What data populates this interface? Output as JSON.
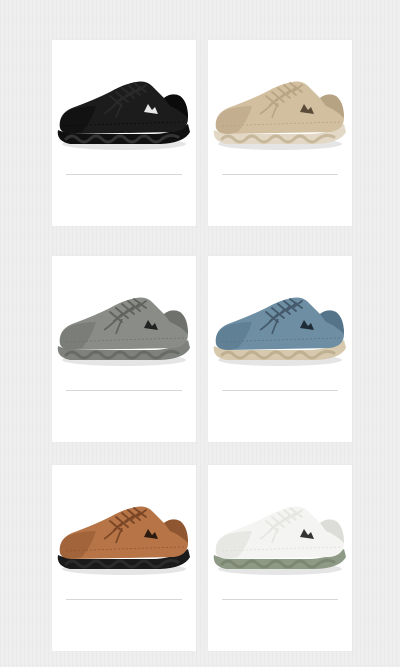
{
  "products": [
    {
      "id": "black",
      "upper": "#1c1c1c",
      "upper_dark": "#0b0b0b",
      "sole": "#101010",
      "lace": "#2a2a2a",
      "tread": "#333333",
      "logo": "#e8e8e8"
    },
    {
      "id": "beige",
      "upper": "#d2bfa0",
      "upper_dark": "#b6a384",
      "sole": "#e3d8c5",
      "lace": "#b9a583",
      "tread": "#c7b89b",
      "logo": "#5a4a38"
    },
    {
      "id": "grey",
      "upper": "#8a8d87",
      "upper_dark": "#6e716c",
      "sole": "#7e817c",
      "lace": "#5f625d",
      "tread": "#686b66",
      "logo": "#222222"
    },
    {
      "id": "blue",
      "upper": "#6e8ea4",
      "upper_dark": "#567489",
      "sole": "#d7c9ad",
      "lace": "#44596a",
      "tread": "#bfb091",
      "logo": "#1f2b35"
    },
    {
      "id": "brown",
      "upper": "#b67447",
      "upper_dark": "#8f5731",
      "sole": "#1a1a1a",
      "lace": "#7a4726",
      "tread": "#2a2a2a",
      "logo": "#2a1a10"
    },
    {
      "id": "white",
      "upper": "#f4f4f2",
      "upper_dark": "#dcdcd8",
      "sole": "#8f9a86",
      "lace": "#e5e5e2",
      "tread": "#7d8873",
      "logo": "#333333"
    }
  ]
}
